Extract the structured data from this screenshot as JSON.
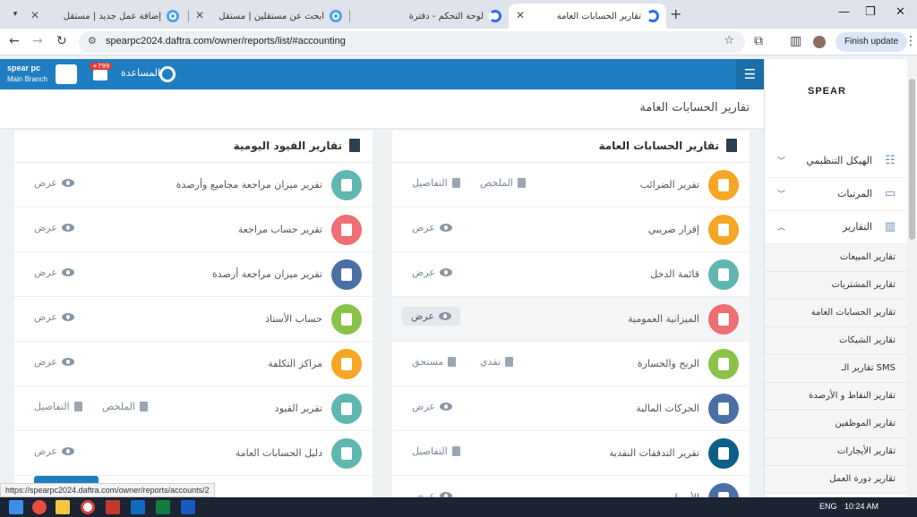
{
  "browser": {
    "tabs": [
      {
        "title": "تقارير الحسابات العامة",
        "active": true
      },
      {
        "title": "لوحة التحكم - دفترة",
        "active": false
      },
      {
        "title": "ابحث عن مستقلين | مستقل",
        "active": false
      },
      {
        "title": "إضافة عمل جديد | مستقل",
        "active": false
      }
    ],
    "url": "spearpc2024.daftra.com/owner/reports/list/#accounting",
    "finish_update": "Finish update",
    "status_url": "https://spearpc2024.daftra.com/owner/reports/accounts/2"
  },
  "header": {
    "help_label": "المساعدة",
    "notif_badge": "+799",
    "brand_name": "spear pc",
    "branch": "Main Branch",
    "color": "#1f7ec1"
  },
  "page_title": "تقارير الحسابات العامة",
  "sidebar": {
    "logo": "SPEAR",
    "main_items": [
      {
        "label": "الهيكل التنظيمي",
        "icon": "org-chart-icon",
        "open": false
      },
      {
        "label": "المرتبات",
        "icon": "money-icon",
        "open": false
      },
      {
        "label": "التقارير",
        "icon": "chart-icon",
        "open": true
      }
    ],
    "sub_items": [
      "تقارير المبيعات",
      "تقارير المشتريات",
      "تقارير الحسابات العامة",
      "تقارير الشيكات",
      "تقارير الـ SMS",
      "تقارير النقاط و الأرصدة",
      "تقارير الموظفين",
      "تقارير الأيجارات",
      "تقارير دورة العمل"
    ]
  },
  "panels": {
    "general": {
      "title": "تقارير الحسابات العامة",
      "rows": [
        {
          "name": "تقرير الضرائب",
          "color": "#f5a623",
          "actions": [
            "التفاصيل",
            "الملخص"
          ]
        },
        {
          "name": "إقرار ضريبي",
          "color": "#f5a623",
          "actions": [
            "عرض"
          ]
        },
        {
          "name": "قائمة الدخل",
          "color": "#5fb7b0",
          "actions": [
            "عرض"
          ]
        },
        {
          "name": "الميزانية العمومية",
          "color": "#ee6e73",
          "actions": [
            "عرض"
          ],
          "highlight": true
        },
        {
          "name": "الربح والخسارة",
          "color": "#8bc34a",
          "actions": [
            "مستحق",
            "نقدي"
          ]
        },
        {
          "name": "الحركات المالية",
          "color": "#4a6fa5",
          "actions": [
            "عرض"
          ]
        },
        {
          "name": "تقرير التدفقات النقدية",
          "color": "#0d5f8a",
          "actions": [
            "التفاصيل"
          ]
        },
        {
          "name": "الأصول",
          "color": "#4a6fa5",
          "actions": [
            "عرض"
          ]
        }
      ]
    },
    "journal": {
      "title": "تقارير القيود اليومية",
      "rows": [
        {
          "name": "تقرير ميزان مراجعة مجاميع وأرصدة",
          "color": "#5fb7b0",
          "actions": [
            "عرض"
          ]
        },
        {
          "name": "تقرير حساب مراجعة",
          "color": "#ee6e73",
          "actions": [
            "عرض"
          ]
        },
        {
          "name": "تقرير ميزان مراجعة أرصدة",
          "color": "#4a6fa5",
          "actions": [
            "عرض"
          ]
        },
        {
          "name": "حساب الأستاذ",
          "color": "#8bc34a",
          "actions": [
            "عرض"
          ]
        },
        {
          "name": "مراكز التكلفة",
          "color": "#f5a623",
          "actions": [
            "عرض"
          ]
        },
        {
          "name": "تقرير القيود",
          "color": "#5fb7b0",
          "actions": [
            "التفاصيل",
            "الملخص"
          ]
        },
        {
          "name": "دليل الحسابات العامة",
          "color": "#5fb7b0",
          "actions": [
            "عرض"
          ]
        }
      ]
    }
  },
  "taskbar": {
    "lang": "ENG",
    "time": "10:24 AM"
  }
}
